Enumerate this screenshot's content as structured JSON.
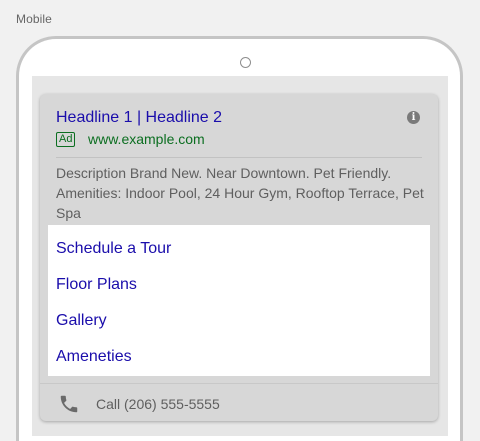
{
  "device_label": "Mobile",
  "ad": {
    "headline": "Headline 1 | Headline 2",
    "badge": "Ad",
    "display_url": "www.example.com",
    "description": "Description Brand New. Near Downtown. Pet Friendly. Amenities: Indoor Pool, 24 Hour Gym, Rooftop Terrace, Pet Spa",
    "sitelinks": [
      "Schedule a Tour",
      "Floor Plans",
      "Gallery",
      "Ameneties"
    ],
    "call_text": "Call (206) 555-5555"
  },
  "icons": {
    "info": "info-icon",
    "call": "phone-icon"
  },
  "colors": {
    "link": "#1a0dab",
    "url_green": "#0b6e20",
    "body_text": "#5f5f5f"
  }
}
